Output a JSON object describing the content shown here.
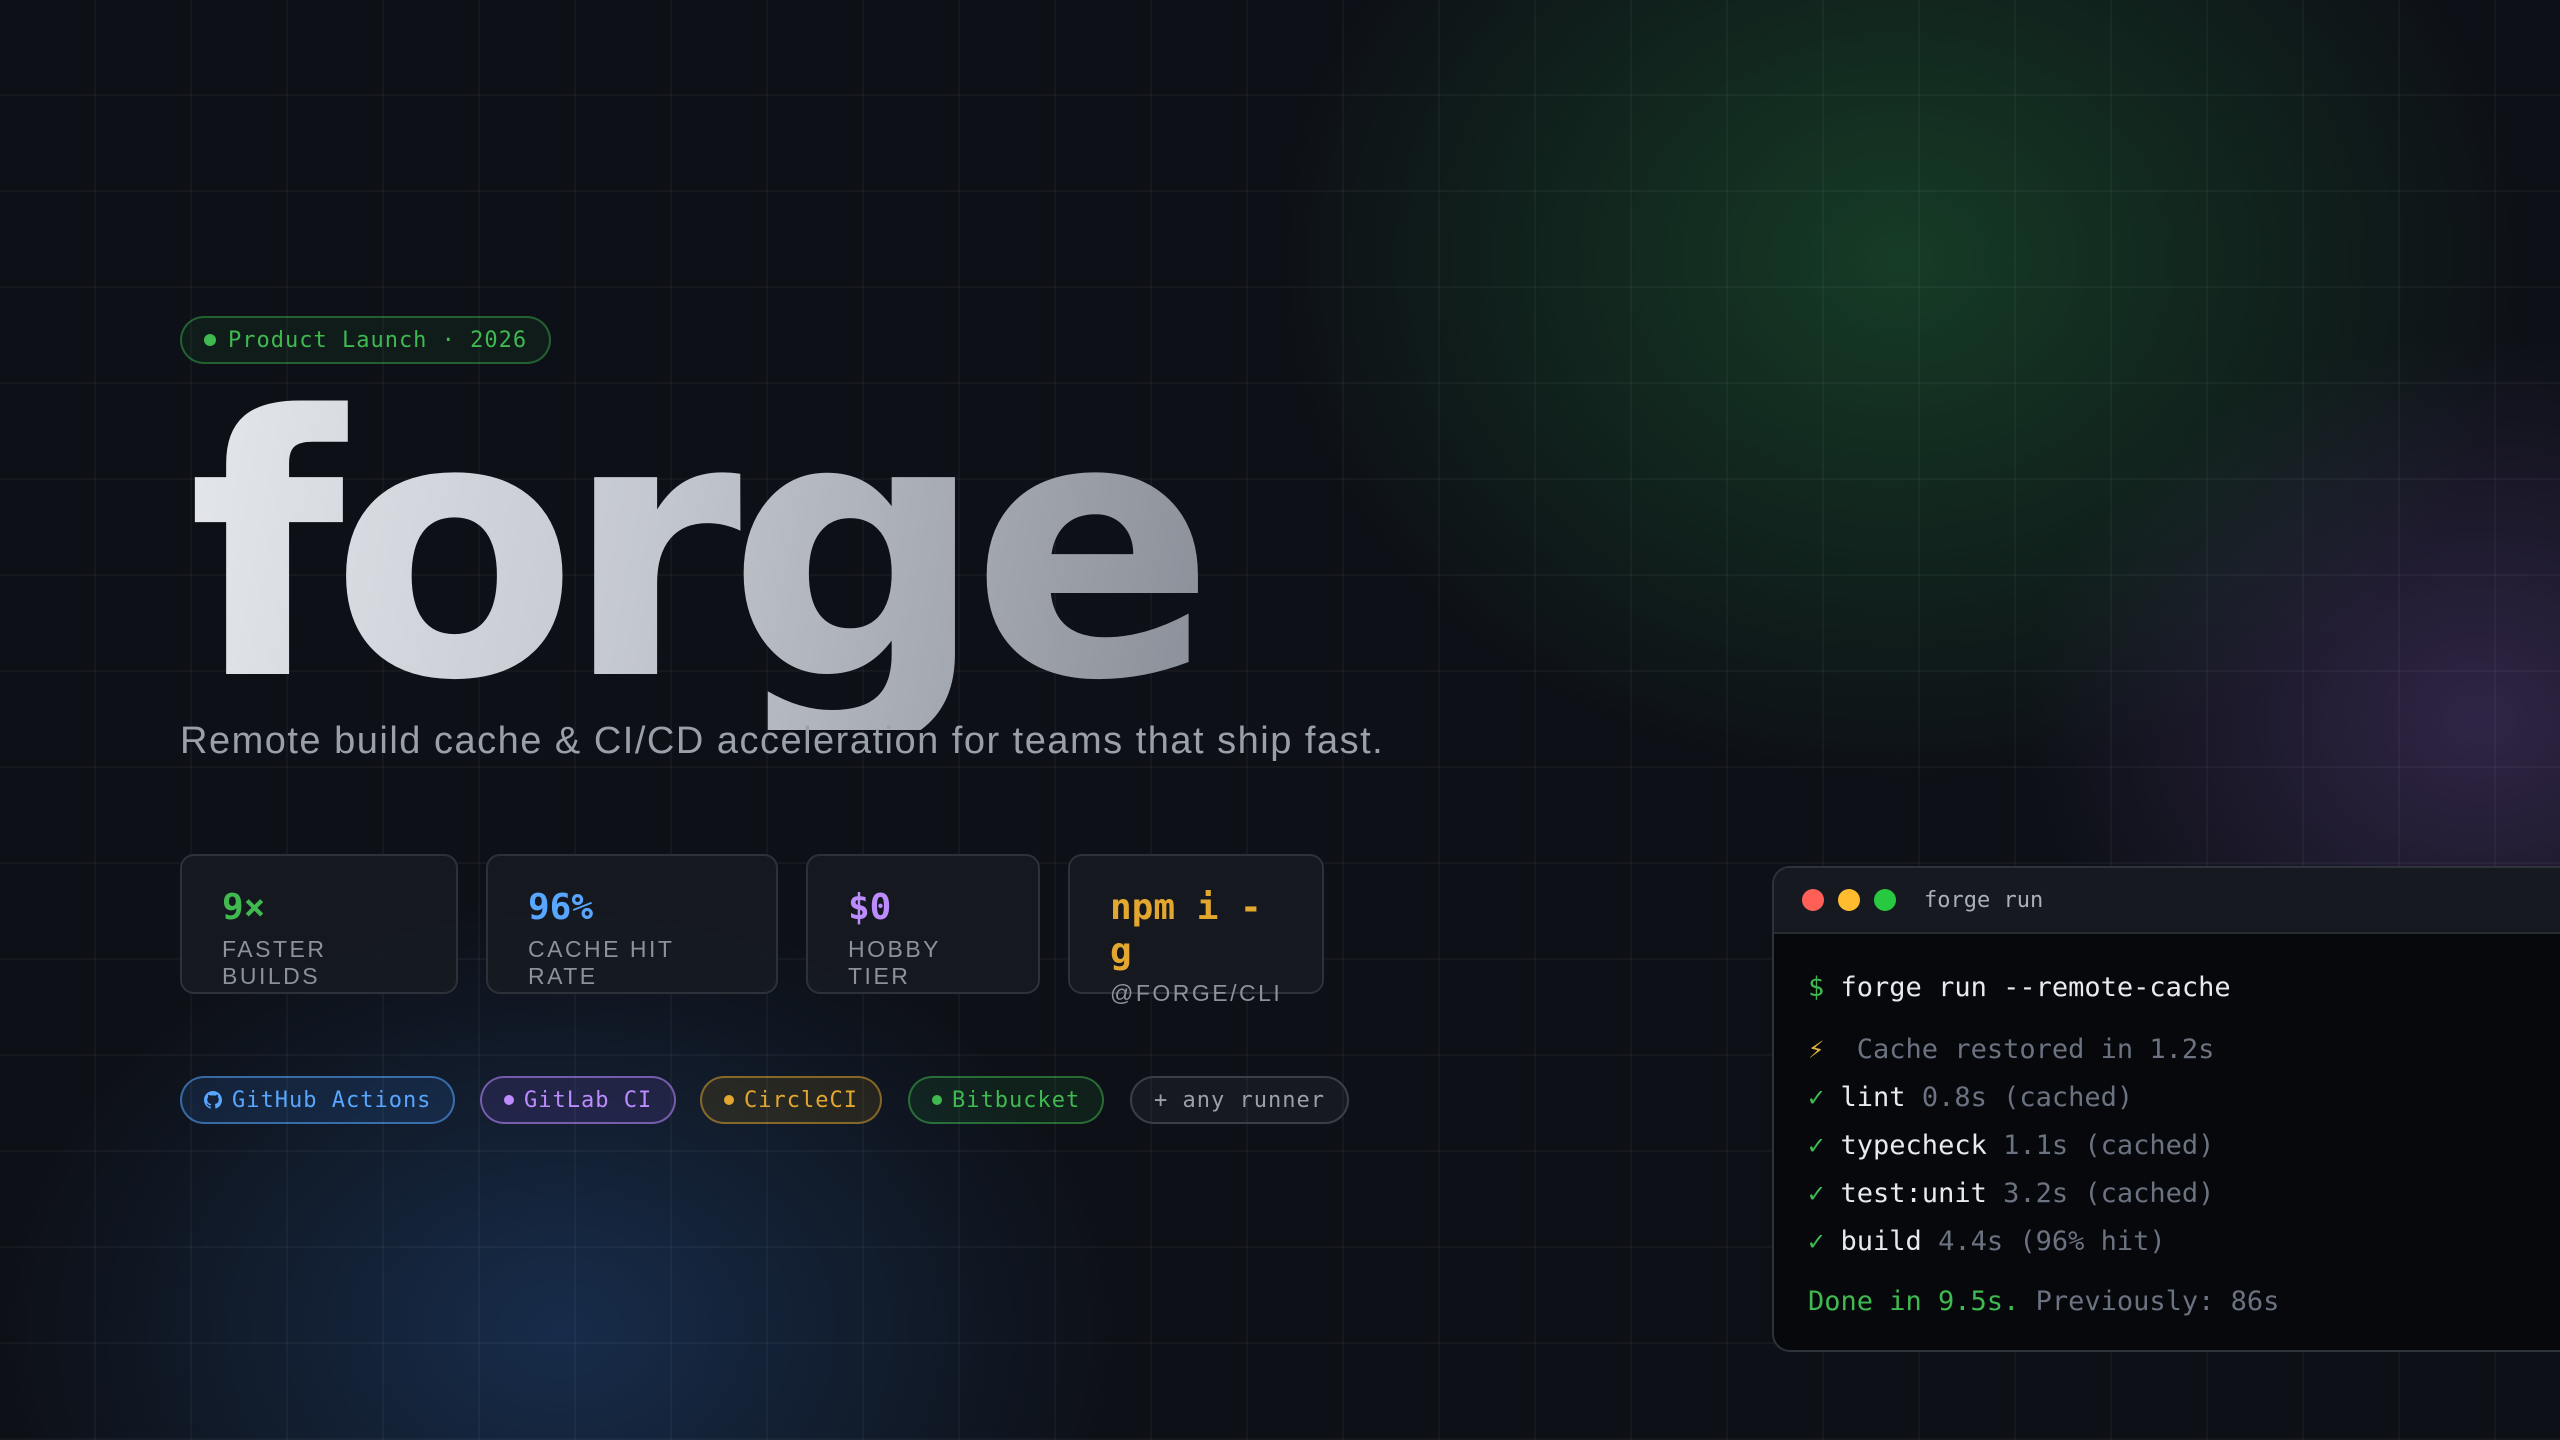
{
  "badge": {
    "text": "Product Launch · 2026"
  },
  "hero": {
    "wordmark": "forge",
    "tagline": "Remote build cache & CI/CD acceleration for teams that ship fast."
  },
  "stats": [
    {
      "value": "9×",
      "label": "Faster builds",
      "color": "#3fb950"
    },
    {
      "value": "96%",
      "label": "Cache hit rate",
      "color": "#58a6ff"
    },
    {
      "value": "$0",
      "label": "Hobby tier",
      "color": "#bc8cff"
    },
    {
      "value": "npm i -g",
      "label": "@forge/cli",
      "color": "#e3a72f"
    }
  ],
  "integrations": [
    {
      "label": "GitHub Actions",
      "icon": "github-icon",
      "color": "#58a6ff"
    },
    {
      "label": "GitLab CI",
      "icon": "dot-icon",
      "color": "#bc8cff"
    },
    {
      "label": "CircleCI",
      "icon": "dot-icon",
      "color": "#e3a72f"
    },
    {
      "label": "Bitbucket",
      "icon": "dot-icon",
      "color": "#3fb950"
    },
    {
      "label": "+ any runner",
      "icon": "",
      "color": "#9aa0a9"
    }
  ],
  "terminal": {
    "title": "forge run",
    "prompt": "$",
    "command": "forge run --remote-cache",
    "cache_icon": "⚡",
    "cache_line": "Cache restored in 1.2s",
    "check": "✓",
    "tasks": [
      {
        "name": "lint",
        "detail": "0.8s (cached)"
      },
      {
        "name": "typecheck",
        "detail": "1.1s (cached)"
      },
      {
        "name": "test:unit",
        "detail": "3.2s (cached)"
      },
      {
        "name": "build",
        "detail": "4.4s (96% hit)"
      }
    ],
    "done": "Done in 9.5s.",
    "previous": "Previously: 86s"
  }
}
